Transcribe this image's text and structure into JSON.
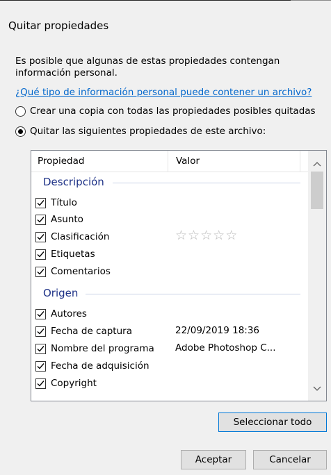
{
  "dialog": {
    "title": "Quitar propiedades",
    "description": "Es posible que algunas de estas propiedades contengan información personal.",
    "link": "¿Qué tipo de información personal puede contener un archivo?"
  },
  "options": {
    "copy": "Crear una copia con todas las propiedades posibles quitadas",
    "remove": "Quitar las siguientes propiedades de este archivo:",
    "selected": "remove"
  },
  "table": {
    "col_property": "Propiedad",
    "col_value": "Valor",
    "groups": [
      {
        "name": "Descripción",
        "items": [
          {
            "label": "Título",
            "value": "",
            "checked": true
          },
          {
            "label": "Asunto",
            "value": "",
            "checked": true
          },
          {
            "label": "Clasificación",
            "value": "",
            "rating": 0,
            "checked": true
          },
          {
            "label": "Etiquetas",
            "value": "",
            "checked": true
          },
          {
            "label": "Comentarios",
            "value": "",
            "checked": true
          }
        ]
      },
      {
        "name": "Origen",
        "items": [
          {
            "label": "Autores",
            "value": "",
            "checked": true
          },
          {
            "label": "Fecha de captura",
            "value": "22/09/2019 18:36",
            "checked": true
          },
          {
            "label": "Nombre del programa",
            "value": "Adobe Photoshop C...",
            "checked": true
          },
          {
            "label": "Fecha de adquisición",
            "value": "",
            "checked": true
          },
          {
            "label": "Copyright",
            "value": "",
            "checked": true
          }
        ]
      }
    ]
  },
  "icons": {
    "scroll_up": "chevron-up-icon",
    "scroll_down": "chevron-down-icon",
    "check": "checkmark-icon",
    "star": "star-icon"
  },
  "buttons": {
    "select_all": "Seleccionar todo",
    "ok": "Aceptar",
    "cancel": "Cancelar"
  }
}
